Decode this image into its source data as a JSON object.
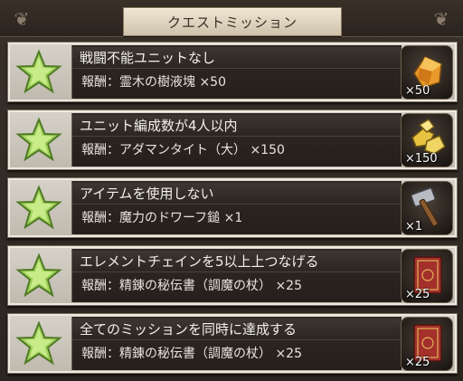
{
  "header": {
    "title": "クエストミッション"
  },
  "missions": [
    {
      "title": "戦闘不能ユニットなし",
      "reward": "報酬：霊木の樹液塊 ×50",
      "qty": "×50",
      "icon": "sap-crystal-icon"
    },
    {
      "title": "ユニット編成数が4人以内",
      "reward": "報酬：アダマンタイト（大） ×150",
      "qty": "×150",
      "icon": "adamantite-icon"
    },
    {
      "title": "アイテムを使用しない",
      "reward": "報酬：魔力のドワーフ鎚 ×1",
      "qty": "×1",
      "icon": "dwarf-hammer-icon"
    },
    {
      "title": "エレメントチェインを5以上上つなげる",
      "reward": "報酬：精錬の秘伝書（調魔の杖） ×25",
      "qty": "×25",
      "icon": "secret-book-icon"
    },
    {
      "title": "全てのミッションを同時に達成する",
      "reward": "報酬：精錬の秘伝書（調魔の杖） ×25",
      "qty": "×25",
      "icon": "secret-book-icon"
    }
  ],
  "colors": {
    "star": "#9fd05a",
    "panel": "#d7d2c9",
    "bar": "#2e2925"
  }
}
